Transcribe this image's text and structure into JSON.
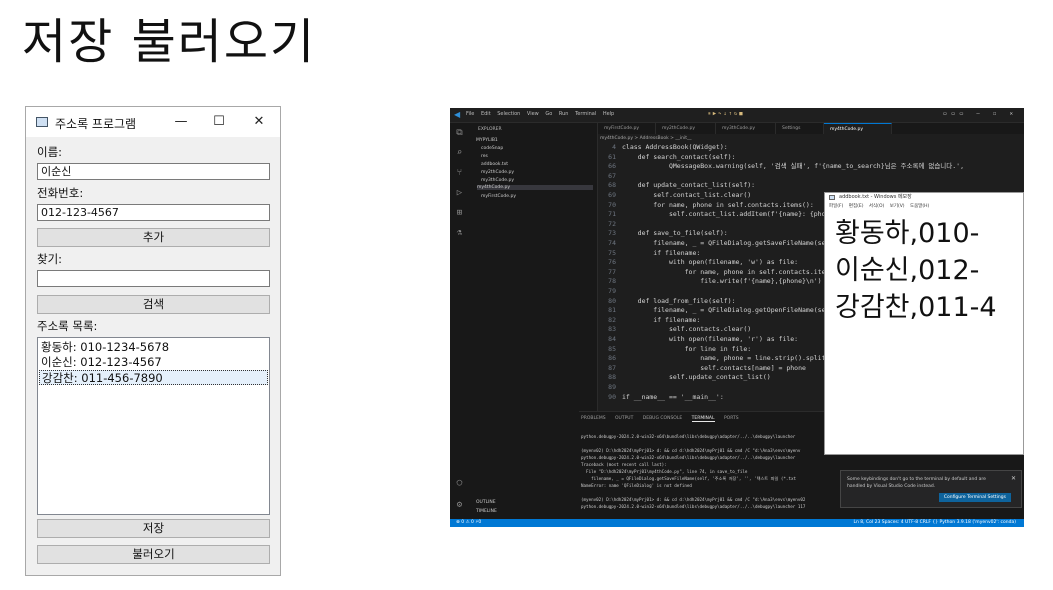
{
  "slide": {
    "title": "저장 불러오기"
  },
  "qt_window": {
    "title": "주소록 프로그램",
    "controls": {
      "minimize": "—",
      "maximize": "☐",
      "close": "✕"
    },
    "name_label": "이름:",
    "name_value": "이순신",
    "phone_label": "전화번호:",
    "phone_value": "012-123-4567",
    "add_button": "추가",
    "search_label": "찾기:",
    "search_value": "",
    "search_button": "검색",
    "list_label": "주소록 목록:",
    "contacts": [
      "황동하: 010-1234-5678",
      "이순신: 012-123-4567",
      "강감찬: 011-456-7890"
    ],
    "selected_index": 2,
    "save_button": "저장",
    "load_button": "불러오기"
  },
  "vscode": {
    "menu": [
      "File",
      "Edit",
      "Selection",
      "View",
      "Go",
      "Run",
      "Terminal",
      "Help"
    ],
    "explorer_header": "EXPLORER",
    "folder": "MYPYLIB1",
    "files": [
      "codeSnap",
      "res",
      "addbook.txt",
      "my2thCode.py",
      "my3thCode.py",
      "my4thCode.py",
      "myFirstCode.py"
    ],
    "outline": "OUTLINE",
    "timeline": "TIMELINE",
    "tabs": [
      "myFirstCode.py",
      "my2thCode.py",
      "my3thCode.py",
      "Settings",
      "my4thCode.py"
    ],
    "breadcrumb": "my4thCode.py > AddressBook > __init__",
    "code": [
      {
        "n": "4",
        "t": "class AddressBook(QWidget):"
      },
      {
        "n": "61",
        "t": "    def search_contact(self):"
      },
      {
        "n": "66",
        "t": "            QMessageBox.warning(self, '검색 실패', f'{name_to_search}님은 주소록에 없습니다.',"
      },
      {
        "n": "67",
        "t": ""
      },
      {
        "n": "68",
        "t": "    def update_contact_list(self):"
      },
      {
        "n": "69",
        "t": "        self.contact_list.clear()"
      },
      {
        "n": "70",
        "t": "        for name, phone in self.contacts.items():"
      },
      {
        "n": "71",
        "t": "            self.contact_list.addItem(f'{name}: {phone}"
      },
      {
        "n": "72",
        "t": ""
      },
      {
        "n": "73",
        "t": "    def save_to_file(self):"
      },
      {
        "n": "74",
        "t": "        filename, _ = QFileDialog.getSaveFileName(self,"
      },
      {
        "n": "75",
        "t": "        if filename:"
      },
      {
        "n": "76",
        "t": "            with open(filename, 'w') as file:"
      },
      {
        "n": "77",
        "t": "                for name, phone in self.contacts.items("
      },
      {
        "n": "78",
        "t": "                    file.write(f'{name},{phone}\\n')"
      },
      {
        "n": "79",
        "t": ""
      },
      {
        "n": "80",
        "t": "    def load_from_file(self):"
      },
      {
        "n": "81",
        "t": "        filename, _ = QFileDialog.getOpenFileName(self,"
      },
      {
        "n": "82",
        "t": "        if filename:"
      },
      {
        "n": "83",
        "t": "            self.contacts.clear()"
      },
      {
        "n": "84",
        "t": "            with open(filename, 'r') as file:"
      },
      {
        "n": "85",
        "t": "                for line in file:"
      },
      {
        "n": "86",
        "t": "                    name, phone = line.strip().split(',"
      },
      {
        "n": "87",
        "t": "                    self.contacts[name] = phone"
      },
      {
        "n": "88",
        "t": "            self.update_contact_list()"
      },
      {
        "n": "89",
        "t": ""
      },
      {
        "n": "90",
        "t": "if __name__ == '__main__':"
      }
    ],
    "panel_tabs": [
      "PROBLEMS",
      "OUTPUT",
      "DEBUG CONSOLE",
      "TERMINAL",
      "PORTS"
    ],
    "terminal": [
      "python.debugpy-2024.2.0-win32-x64\\bundled\\libs\\debugpy\\adapter/../..\\debugpy\\launcher",
      "",
      "(myenv02) D:\\hdh2024\\myPrj01> d: && cd d:\\hdh2024\\myPrj01 && cmd /C \"d:\\Ana3\\envs\\myenv",
      "python.debugpy-2024.2.0-win32-x64\\bundled\\libs\\debugpy\\adapter/../..\\debugpy\\launcher",
      "Traceback (most recent call last):",
      "  File \"D:\\hdh2024\\myPrj01\\my4thCode.py\", line 74, in save_to_file",
      "    filename, _ = QFileDialog.getSaveFileName(self, '주소록 저장', '', '텍스트 파일 (*.txt",
      "NameError: name 'QFileDialog' is not defined",
      "",
      "(myenv02) D:\\hdh2024\\myPrj01> d: && cd d:\\hdh2024\\myPrj01 && cmd /C \"d:\\Ana3\\envs\\myenv02",
      "python.debugpy-2024.2.0-win32-x64\\bundled\\libs\\debugpy\\adapter/../..\\debugpy\\launcher 117"
    ],
    "notification": "Some keybindings don't go to the terminal by default and are handled by Visual Studio Code instead.",
    "notification_button": "Configure Terminal Settings",
    "status_left": "⊗ 0 ⚠ 0   ⚡0",
    "status_right": "Ln 8, Col 23   Spaces: 4   UTF-8   CRLF   {} Python   3.9.18 ('myenv02': conda)"
  },
  "notepad": {
    "title": "addbook.txt - Windows 메모장",
    "menu": [
      "파일(F)",
      "편집(E)",
      "서식(O)",
      "보기(V)",
      "도움말(H)"
    ],
    "lines": [
      "황동하,010-",
      "이순신,012-",
      "강감찬,011-4"
    ]
  },
  "colors": {
    "vscode_bg": "#1e1e1e",
    "vscode_accent": "#0078d4",
    "qt_bg": "#f0f0f0",
    "selection": "#e5f0fb"
  }
}
